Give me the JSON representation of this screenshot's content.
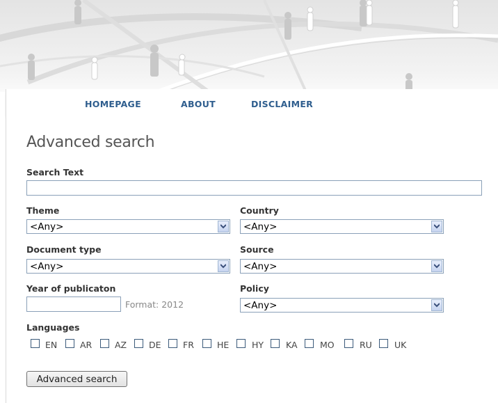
{
  "nav": {
    "homepage": "HOMEPAGE",
    "about": "ABOUT",
    "disclaimer": "DISCLAIMER"
  },
  "page": {
    "title": "Advanced search"
  },
  "form": {
    "search_text": {
      "label": "Search Text",
      "value": ""
    },
    "theme": {
      "label": "Theme",
      "selected": "<Any>"
    },
    "country": {
      "label": "Country",
      "selected": "<Any>"
    },
    "document_type": {
      "label": "Document type",
      "selected": "<Any>"
    },
    "source": {
      "label": "Source",
      "selected": "<Any>"
    },
    "year": {
      "label": "Year of publicaton",
      "value": "",
      "hint": "Format: 2012"
    },
    "policy": {
      "label": "Policy",
      "selected": "<Any>"
    },
    "languages": {
      "label": "Languages",
      "options": [
        "EN",
        "AR",
        "AZ",
        "DE",
        "FR",
        "HE",
        "HY",
        "KA",
        "MO",
        "RU",
        "UK"
      ]
    },
    "submit_label": "Advanced search"
  },
  "colors": {
    "nav_link": "#2f5e8e",
    "title": "#555555",
    "input_border": "#8aa0b8"
  }
}
